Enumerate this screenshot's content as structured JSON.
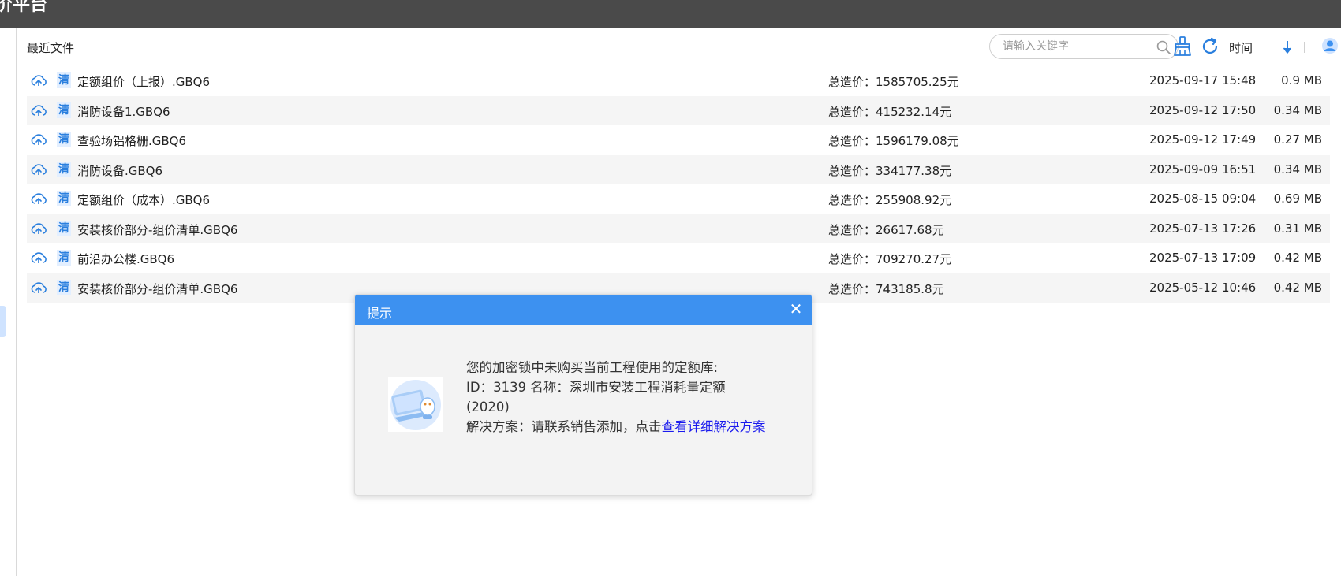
{
  "app": {
    "title_fragment": "价平台"
  },
  "header": {
    "section_title": "最近文件",
    "search_placeholder": "请输入关键字",
    "sort_label": "时间"
  },
  "colors": {
    "topbar": "#4a4a4a",
    "accent": "#3d91f0",
    "link": "#1a1aee",
    "row_alt": "#f5f5f5"
  },
  "files": [
    {
      "tag": "清",
      "name": "定额组价（上报）.GBQ6",
      "price": "总造价：1585705.25元",
      "time": "2025-09-17 15:48",
      "size": "0.9  MB"
    },
    {
      "tag": "清",
      "name": "消防设备1.GBQ6",
      "price": "总造价：415232.14元",
      "time": "2025-09-12 17:50",
      "size": "0.34  MB"
    },
    {
      "tag": "清",
      "name": "查验场铝格栅.GBQ6",
      "price": "总造价：1596179.08元",
      "time": "2025-09-12 17:49",
      "size": "0.27  MB"
    },
    {
      "tag": "清",
      "name": "消防设备.GBQ6",
      "price": "总造价：334177.38元",
      "time": "2025-09-09 16:51",
      "size": "0.34  MB"
    },
    {
      "tag": "清",
      "name": "定额组价（成本）.GBQ6",
      "price": "总造价：255908.92元",
      "time": "2025-08-15 09:04",
      "size": "0.69  MB"
    },
    {
      "tag": "清",
      "name": "安装核价部分-组价清单.GBQ6",
      "price": "总造价：26617.68元",
      "time": "2025-07-13 17:26",
      "size": "0.31  MB"
    },
    {
      "tag": "清",
      "name": "前沿办公楼.GBQ6",
      "price": "总造价：709270.27元",
      "time": "2025-07-13 17:09",
      "size": "0.42  MB"
    },
    {
      "tag": "清",
      "name": "安装核价部分-组价清单.GBQ6",
      "price": "总造价：743185.8元",
      "time": "2025-05-12 10:46",
      "size": "0.42  MB"
    }
  ],
  "dialog": {
    "title": "提示",
    "close": "✕",
    "line1": "您的加密锁中未购买当前工程使用的定额库:",
    "line2": "ID：3139 名称：深圳市安装工程消耗量定额",
    "line3": "(2020)",
    "line4_prefix": "解决方案：请联系销售添加，点击",
    "link": "查看详细解决方案"
  }
}
